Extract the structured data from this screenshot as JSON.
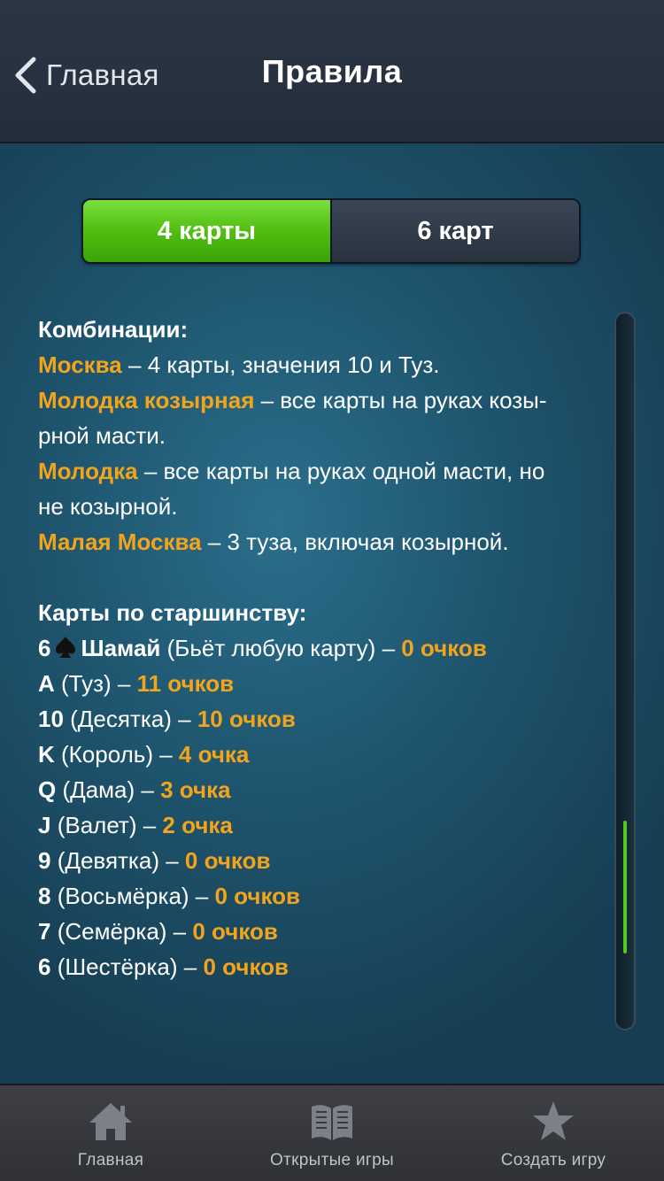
{
  "nav": {
    "back_label": "Главная",
    "title": "Правила"
  },
  "segments": {
    "option_1": "4 карты",
    "option_2": "6 карт",
    "selected": "4 карты"
  },
  "combinations": {
    "heading": "Комбинации:",
    "items": [
      {
        "name": "Москва",
        "desc": " – 4 карты, значения 10 и Туз."
      },
      {
        "name": "Молодка козырная",
        "desc": " – все карты на руках козы-",
        "desc_cont": "рной масти."
      },
      {
        "name": "Молодка",
        "desc": " – все карты на руках одной масти, но",
        "desc_cont": "не козырной."
      },
      {
        "name": "Малая Москва",
        "desc": " – 3 туза, включая козырной."
      }
    ]
  },
  "ranking": {
    "heading": "Карты по старшинству:",
    "special": {
      "rank": "6",
      "name": "Шамай",
      "desc": " (Бьёт любую карту) – ",
      "points": "0 очков",
      "suit_icon": "spade-icon"
    },
    "items": [
      {
        "rank": "A",
        "name": " (Туз) – ",
        "points": "11 очков"
      },
      {
        "rank": "10",
        "name": " (Десятка) – ",
        "points": "10 очков"
      },
      {
        "rank": "K",
        "name": " (Король) – ",
        "points": "4 очка"
      },
      {
        "rank": "Q",
        "name": " (Дама) – ",
        "points": "3 очка"
      },
      {
        "rank": "J",
        "name": " (Валет) – ",
        "points": "2 очка"
      },
      {
        "rank": "9",
        "name": " (Девятка) – ",
        "points": "0 очков"
      },
      {
        "rank": "8",
        "name": " (Восьмёрка) – ",
        "points": "0 очков"
      },
      {
        "rank": "7",
        "name": " (Семёрка) – ",
        "points": "0 очков"
      },
      {
        "rank": "6",
        "name": " (Шестёрка) – ",
        "points": "0 очков"
      }
    ]
  },
  "scrollbar": {
    "position": 0.88,
    "visible_fraction": 0.19
  },
  "tabbar": {
    "items": [
      {
        "label": "Главная",
        "icon": "home-icon"
      },
      {
        "label": "Открытые игры",
        "icon": "book-icon"
      },
      {
        "label": "Создать игру",
        "icon": "star-icon"
      }
    ]
  },
  "colors": {
    "accent_orange": "#f1a41c",
    "segment_green": "#4fbf0f",
    "scroll_green": "#54c81c"
  }
}
